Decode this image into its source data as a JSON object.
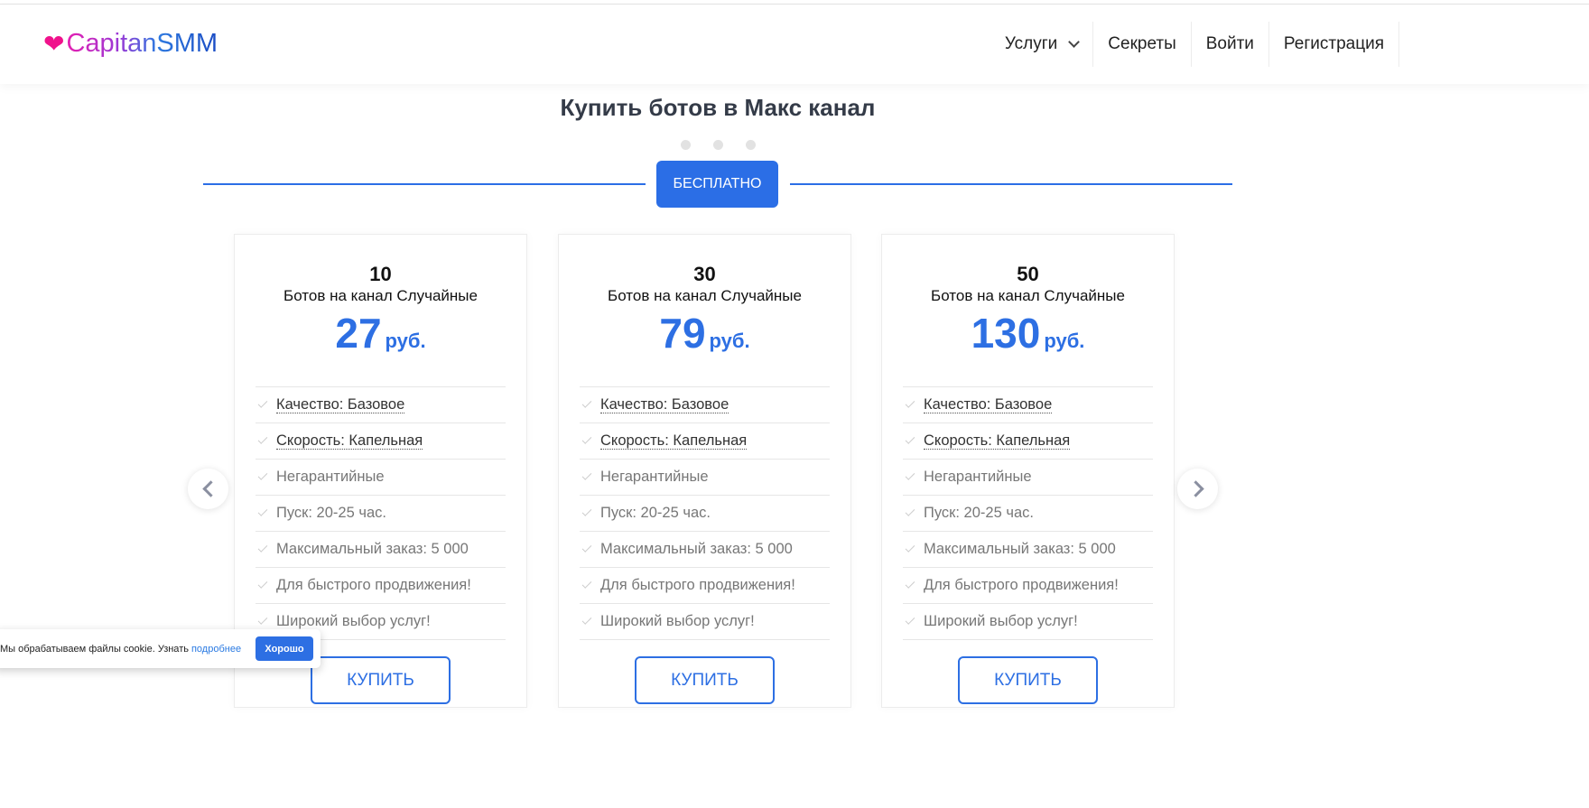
{
  "header": {
    "logo": "CapitanSMM",
    "nav": [
      {
        "label": "Услуги"
      },
      {
        "label": "Секреты"
      },
      {
        "label": "Войти"
      },
      {
        "label": "Регистрация"
      }
    ]
  },
  "title": "Купить ботов в Макс канал",
  "carousel": {
    "pages": 3,
    "tab_label": "БЕСПЛАТНО"
  },
  "cards": [
    {
      "amount": "10",
      "subtitle": "Ботов на канал Случайные",
      "price": "27",
      "currency": "руб.",
      "buy": "КУПИТЬ"
    },
    {
      "amount": "30",
      "subtitle": "Ботов на канал Случайные",
      "price": "79",
      "currency": "руб.",
      "buy": "КУПИТЬ"
    },
    {
      "amount": "50",
      "subtitle": "Ботов на канал Случайные",
      "price": "130",
      "currency": "руб.",
      "buy": "КУПИТЬ"
    }
  ],
  "features": [
    "Качество: Базовое",
    "Скорость: Капельная",
    "Негарантийные",
    "Пуск: 20-25 час.",
    "Максимальный заказ: 5 000",
    "Для быстрого продвижения!",
    "Широкий выбор услуг!"
  ],
  "cookie": {
    "text": "Мы обрабатываем файлы cookie. Узнать",
    "link": "подробнее",
    "button": "Хорошо"
  },
  "colors": {
    "accent": "#2d6fe3",
    "heart": "#f0128c"
  }
}
